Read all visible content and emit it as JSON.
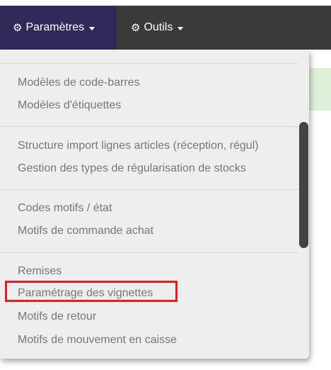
{
  "navbar": {
    "menus": [
      {
        "label": "Paramètres",
        "icon": "gear-icon",
        "open": true
      },
      {
        "label": "Outils",
        "icon": "gear-icon",
        "open": false
      }
    ]
  },
  "dropdown": {
    "items": [
      {
        "label": "Modèles de code-barres"
      },
      {
        "label": "Modèles d'étiquettes"
      },
      {
        "label": "Structure import lignes articles (réception, régul)"
      },
      {
        "label": "Gestion des types de régularisation de stocks"
      },
      {
        "label": "Codes motifs / état"
      },
      {
        "label": "Motifs de commande achat"
      },
      {
        "label": "Remises"
      },
      {
        "label": "Paramétrage des vignettes",
        "highlighted": true
      },
      {
        "label": "Motifs de retour"
      },
      {
        "label": "Motifs de mouvement en caisse"
      }
    ]
  },
  "colors": {
    "navbar_bg": "#3a3a3a",
    "active_menu_bg": "#302a5a",
    "highlight_border": "#e02020"
  }
}
